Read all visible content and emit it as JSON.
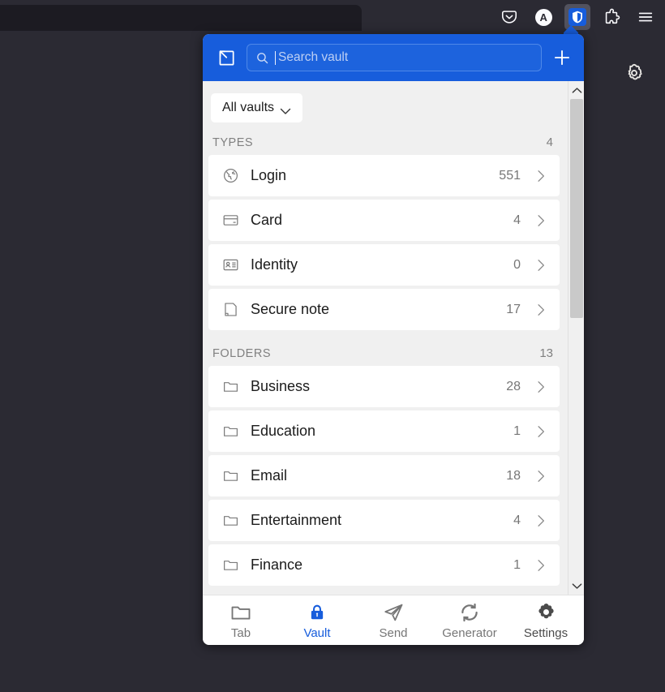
{
  "browser": {
    "toolbar_buttons": [
      {
        "name": "pocket-icon",
        "label": "Pocket"
      },
      {
        "name": "account-avatar",
        "label": "A"
      },
      {
        "name": "bitwarden-extension-icon",
        "label": "Bitwarden"
      },
      {
        "name": "extensions-icon",
        "label": "Extensions"
      },
      {
        "name": "app-menu-icon",
        "label": "Open application menu"
      }
    ],
    "page_gear_label": "Settings"
  },
  "popup": {
    "header": {
      "popout_label": "Pop out",
      "search_placeholder": "Search vault",
      "search_value": "",
      "add_label": "Add item"
    },
    "vault_filter": {
      "label": "All vaults",
      "chevron": "chevron-down-icon"
    },
    "sections": [
      {
        "id": "types",
        "title": "TYPES",
        "count": "4",
        "rows": [
          {
            "icon": "globe-icon",
            "label": "Login",
            "count": "551",
            "chevron": "chevron-right-icon"
          },
          {
            "icon": "credit-card-icon",
            "label": "Card",
            "count": "4",
            "chevron": "chevron-right-icon"
          },
          {
            "icon": "id-card-icon",
            "label": "Identity",
            "count": "0",
            "chevron": "chevron-right-icon"
          },
          {
            "icon": "note-icon",
            "label": "Secure note",
            "count": "17",
            "chevron": "chevron-right-icon"
          }
        ]
      },
      {
        "id": "folders",
        "title": "FOLDERS",
        "count": "13",
        "rows": [
          {
            "icon": "folder-icon",
            "label": "Business",
            "count": "28",
            "chevron": "chevron-right-icon"
          },
          {
            "icon": "folder-icon",
            "label": "Education",
            "count": "1",
            "chevron": "chevron-right-icon"
          },
          {
            "icon": "folder-icon",
            "label": "Email",
            "count": "18",
            "chevron": "chevron-right-icon"
          },
          {
            "icon": "folder-icon",
            "label": "Entertainment",
            "count": "4",
            "chevron": "chevron-right-icon"
          },
          {
            "icon": "folder-icon",
            "label": "Finance",
            "count": "1",
            "chevron": "chevron-right-icon"
          }
        ]
      }
    ],
    "scrollbar": {
      "up_label": "Scroll up",
      "down_label": "Scroll down"
    },
    "bottom_nav": [
      {
        "icon": "folder-icon",
        "label": "Tab",
        "state": "grey"
      },
      {
        "icon": "lock-icon",
        "label": "Vault",
        "state": "active"
      },
      {
        "icon": "send-icon",
        "label": "Send",
        "state": "grey"
      },
      {
        "icon": "generator-icon",
        "label": "Generator",
        "state": "grey"
      },
      {
        "icon": "gear-icon",
        "label": "Settings",
        "state": "dark"
      }
    ]
  },
  "colors": {
    "brand_blue": "#175ddc",
    "popup_bg": "#f0f0f0",
    "row_bg": "#ffffff",
    "chrome_bg": "#2b2a33",
    "tab_bg": "#1c1b22"
  }
}
